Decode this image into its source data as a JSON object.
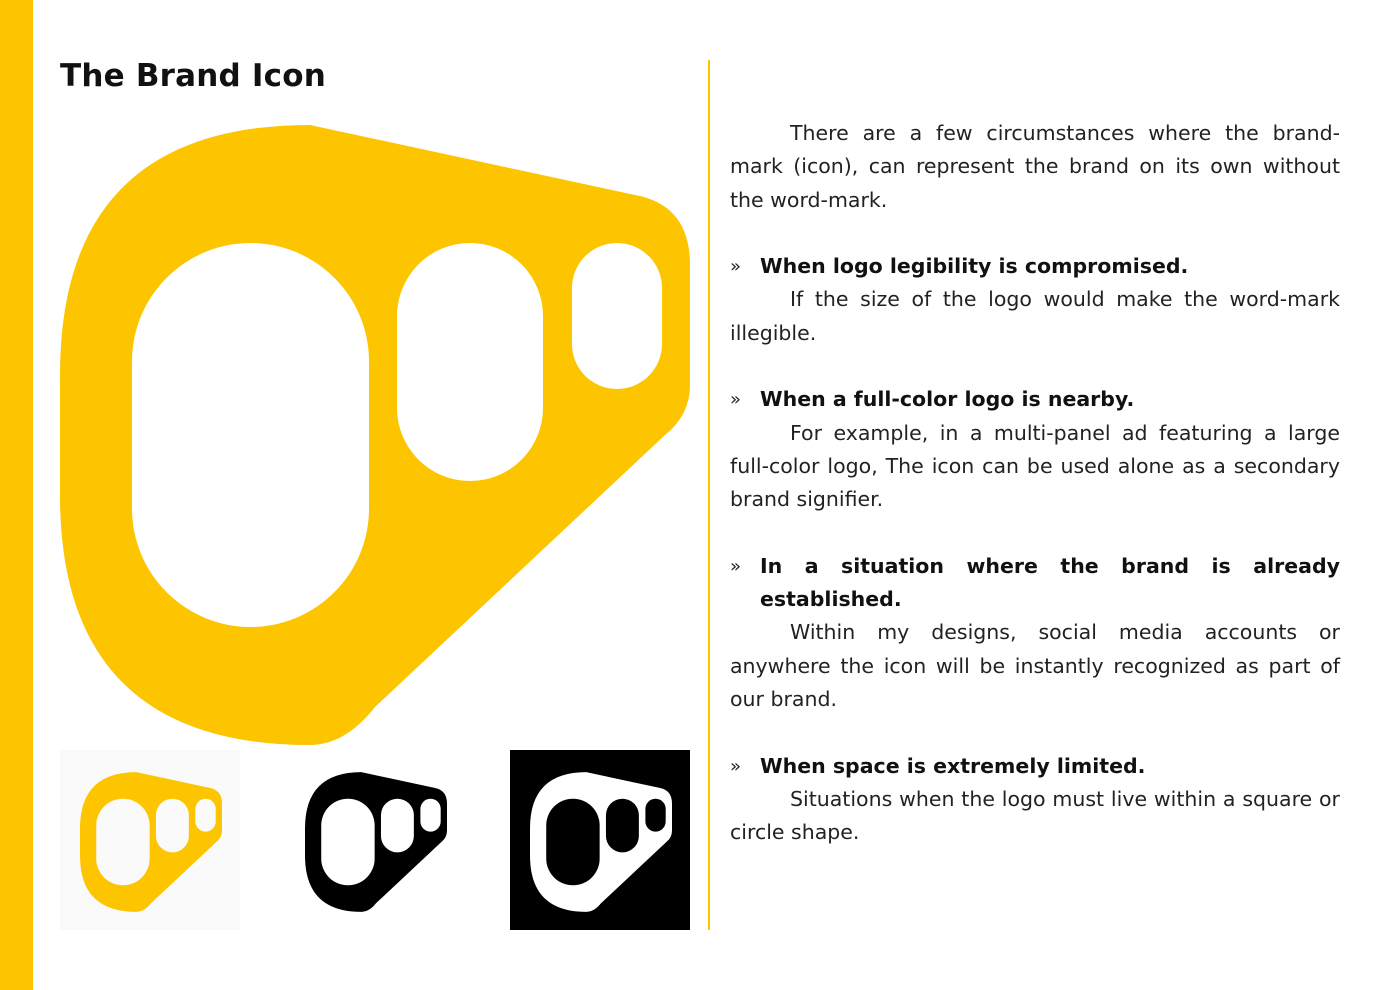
{
  "page": {
    "title": "The Brand Icon"
  },
  "colors": {
    "brand_yellow": "#fcc500",
    "black": "#000000",
    "white": "#ffffff"
  },
  "icons": {
    "large": "brand-icon-yellow",
    "variants": [
      "brand-icon-yellow",
      "brand-icon-black",
      "brand-icon-inverted"
    ]
  },
  "content": {
    "intro": "There are a few circumstances where the brand-mark (icon), can represent the brand on its own without the word-mark.",
    "bullet_marker": "»",
    "bullets": [
      {
        "heading": "When logo legibility is compromised.",
        "body": "If the size of the logo would make the word-mark illegible."
      },
      {
        "heading": "When a full-color logo is nearby.",
        "body": "For example, in a multi-panel ad featuring a large full-color logo, The icon can be used alone as a secondary brand signifier."
      },
      {
        "heading": "In a situation where the brand is already established.",
        "body": "Within my designs, social media accounts or anywhere the icon will be instantly recognized as part of our brand."
      },
      {
        "heading": "When space is extremely limited.",
        "body": "Situations when the logo must live within a square or circle shape."
      }
    ]
  }
}
